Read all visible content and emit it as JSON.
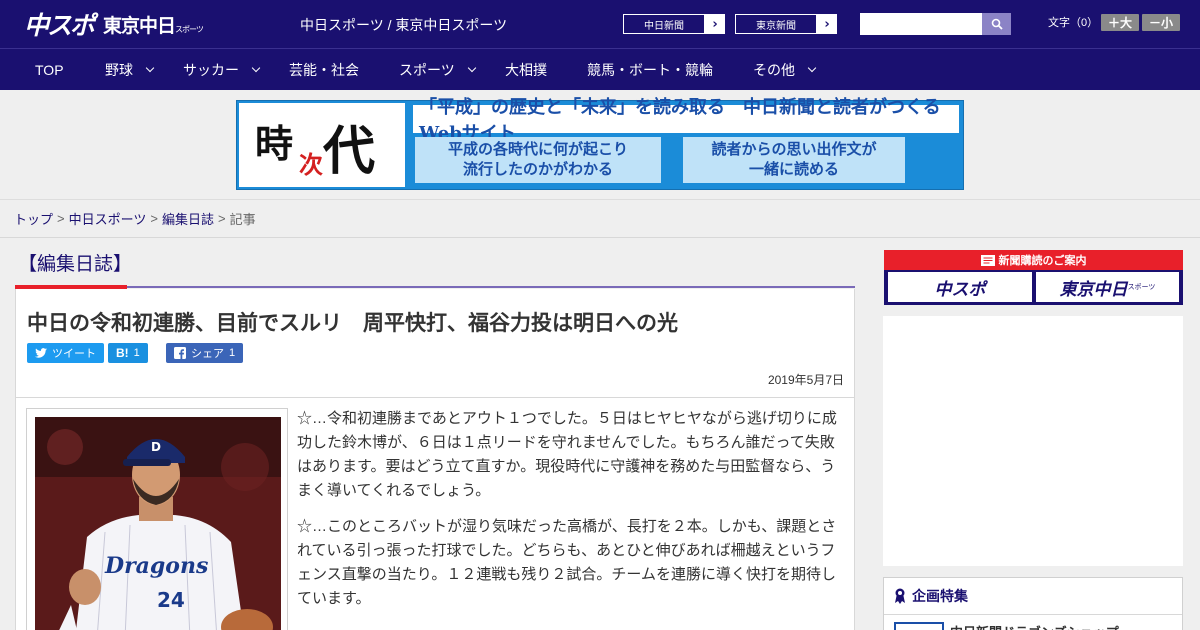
{
  "header": {
    "logo_chuspo": "中スポ",
    "logo_tokyo": "東京中日",
    "logo_tokyo_small": "スポーツ",
    "site_names": "中日スポーツ / 東京中日スポーツ",
    "btn_chunichi": "中日新聞",
    "btn_tokyo": "東京新聞",
    "search_placeholder": "",
    "font_label": "文字（0）",
    "font_larger": "＋大",
    "font_smaller": "－小"
  },
  "nav": {
    "items": [
      "TOP",
      "野球",
      "サッカー",
      "芸能・社会",
      "スポーツ",
      "大相撲",
      "競馬・ボート・競輪",
      "その他"
    ]
  },
  "banner": {
    "kanji_1": "時",
    "kanji_2": "次",
    "kanji_3": "代",
    "headline": "「平成」の歴史と「未来」を読み取る　中日新聞と読者がつくるWebサイト",
    "sub_left": "平成の各時代に何が起こり\n流行したのかがわかる",
    "sub_right": "読者からの思い出作文が\n一緒に読める"
  },
  "breadcrumb": {
    "items": [
      "トップ",
      "中日スポーツ",
      "編集日誌"
    ],
    "current": "記事"
  },
  "section": {
    "title": "【編集日誌】"
  },
  "article": {
    "title": "中日の令和初連勝、目前でスルリ　周平快打、福谷力投は明日への光",
    "share_tweet": "ツイート",
    "share_hatena_label": "B!",
    "share_hatena_count": "1",
    "share_fb_label": "シェア",
    "share_fb_count": "1",
    "date": "2019年5月7日",
    "paragraphs": [
      "☆…令和初連勝まであとアウト１つでした。５日はヒヤヒヤながら逃げ切りに成功した鈴木博が、６日は１点リードを守れませんでした。もちろん誰だって失敗はあります。要はどう立て直すか。現役時代に守護神を務めた与田監督なら、うまく導いてくれるでしょう。",
      "☆…このところバットが湿り気味だった高橋が、長打を２本。しかも、課題とされている引っ張った打球でした。どちらも、あとひと伸びあれば柵越えというフェンス直撃の当たり。１２連戦も残り２試合。チームを連勝に導く快打を期待しています。"
    ],
    "photo_jersey_text": "Dragons",
    "photo_number": "24"
  },
  "sidebar": {
    "subscribe_head": "新聞購読のご案内",
    "subscribe_btn_1": "中スポ",
    "subscribe_btn_2": "東京中日",
    "subscribe_btn_2_small": "スポーツ",
    "feature_title": "企画特集",
    "feature_item": "中日新聞ドラゴンズショップ"
  },
  "colors": {
    "brand_navy": "#1a1070",
    "accent_red": "#e8202a",
    "banner_blue": "#1b8cd8"
  }
}
